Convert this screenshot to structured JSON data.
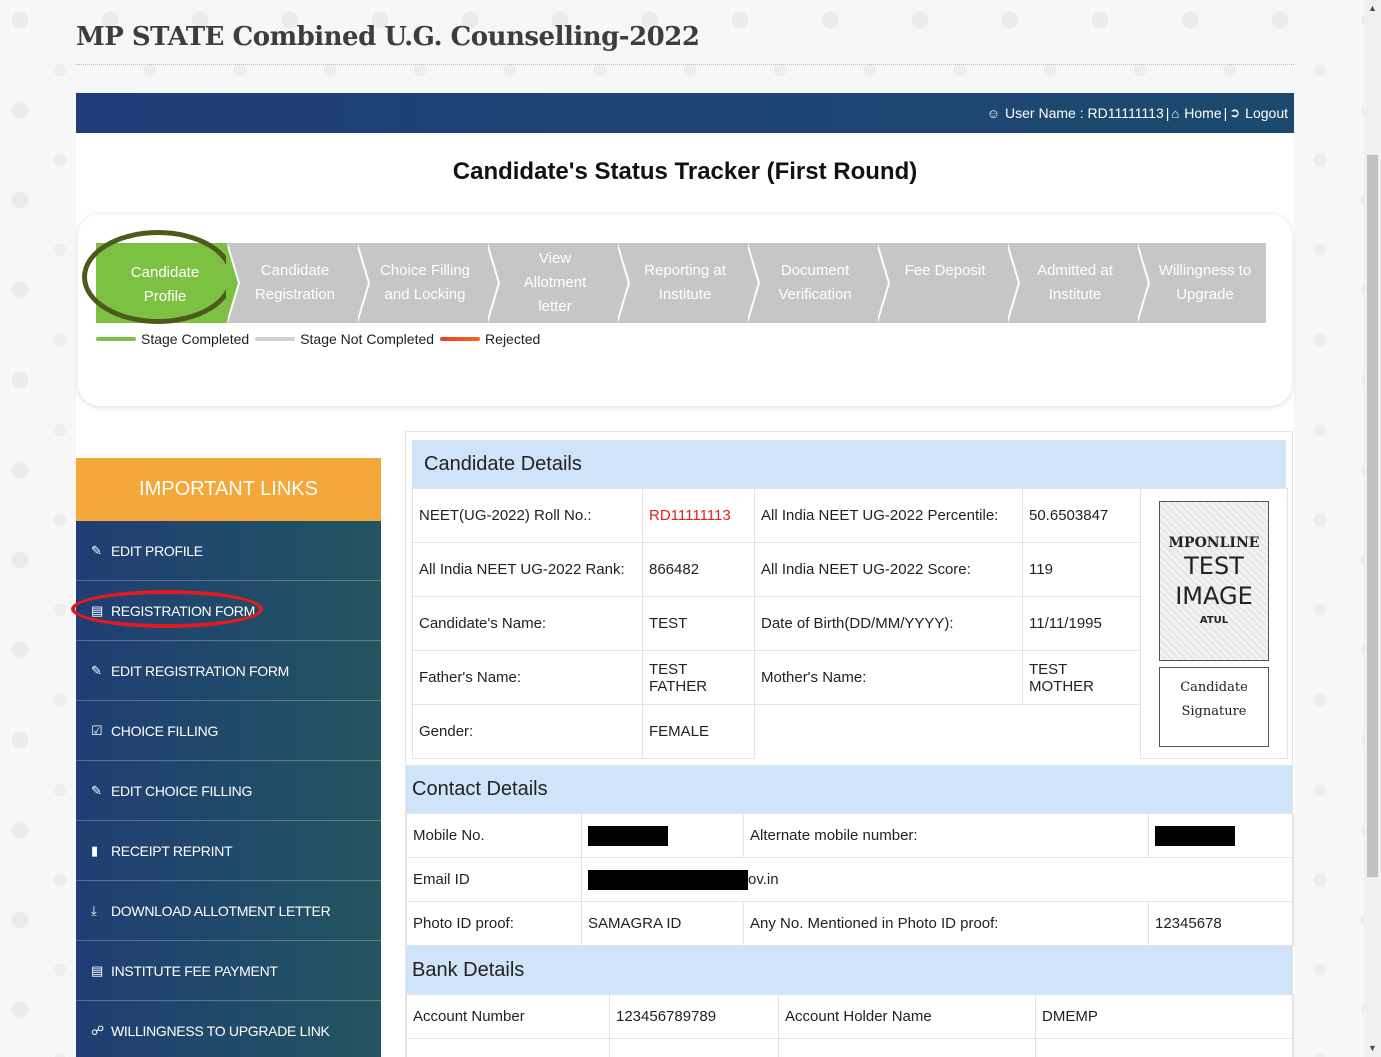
{
  "site_title": "MP STATE Combined U.G. Counselling-2022",
  "topbar": {
    "user_label": "User Name : RD11111113",
    "sep1": "|",
    "home_label": "Home",
    "sep2": "|",
    "logout_label": "Logout"
  },
  "tracker": {
    "title": "Candidate's Status Tracker (First Round)",
    "steps": [
      {
        "label": "Candidate Profile",
        "status": "completed"
      },
      {
        "label": "Candidate Registration",
        "status": "not-completed"
      },
      {
        "label": "Choice Filling and Locking",
        "status": "not-completed"
      },
      {
        "label": "View Allotment letter",
        "status": "not-completed"
      },
      {
        "label": "Reporting at Institute",
        "status": "not-completed"
      },
      {
        "label": "Document Verification",
        "status": "not-completed"
      },
      {
        "label": "Fee Deposit",
        "status": "not-completed"
      },
      {
        "label": "Admitted at Institute",
        "status": "not-completed"
      },
      {
        "label": "Willingness to Upgrade",
        "status": "not-completed"
      }
    ],
    "legend": {
      "completed": "Stage Completed",
      "not_completed": "Stage Not Completed",
      "rejected": "Rejected"
    },
    "colors": {
      "completed": "#7cc142",
      "not_completed": "#c6c6c6",
      "rejected": "#e8402a"
    }
  },
  "links": {
    "heading": "IMPORTANT LINKS",
    "items": [
      {
        "label": "EDIT PROFILE",
        "icon": "edit-icon"
      },
      {
        "label": "REGISTRATION FORM",
        "icon": "id-card-icon"
      },
      {
        "label": "EDIT REGISTRATION FORM",
        "icon": "edit-icon"
      },
      {
        "label": "CHOICE FILLING",
        "icon": "checkbox-icon"
      },
      {
        "label": "EDIT CHOICE FILLING",
        "icon": "edit-icon"
      },
      {
        "label": "RECEIPT REPRINT",
        "icon": "file-icon"
      },
      {
        "label": "DOWNLOAD ALLOTMENT LETTER",
        "icon": "download-icon"
      },
      {
        "label": "INSTITUTE FEE PAYMENT",
        "icon": "credit-card-icon"
      },
      {
        "label": "WILLINGNESS TO UPGRADE LINK",
        "icon": "link-icon"
      }
    ]
  },
  "candidate": {
    "heading": "Candidate Details",
    "roll_label": "NEET(UG-2022) Roll No.:",
    "roll_value": "RD11111113",
    "percentile_label": "All India NEET UG-2022 Percentile:",
    "percentile_value": "50.6503847",
    "rank_label": "All India NEET UG-2022 Rank:",
    "rank_value": "866482",
    "score_label": "All India NEET UG-2022 Score:",
    "score_value": "119",
    "name_label": "Candidate's Name:",
    "name_value": "TEST",
    "dob_label": "Date of Birth(DD/MM/YYYY):",
    "dob_value": "11/11/1995",
    "father_label": "Father's Name:",
    "father_value": "TEST FATHER",
    "mother_label": "Mother's Name:",
    "mother_value": "TEST MOTHER",
    "gender_label": "Gender:",
    "gender_value": "FEMALE",
    "photo": {
      "line1": "MPONLINE",
      "line2": "TEST",
      "line3": "IMAGE",
      "line4": "ATUL"
    },
    "signature": {
      "line1": "Candidate",
      "line2": "Signature"
    }
  },
  "contact": {
    "heading": "Contact Details",
    "mobile_label": "Mobile No.",
    "alt_mobile_label": "Alternate mobile number:",
    "email_label": "Email ID",
    "email_suffix": "ov.in",
    "photo_id_label": "Photo ID proof:",
    "photo_id_value": "SAMAGRA ID",
    "photo_id_no_label": "Any No. Mentioned in Photo ID proof:",
    "photo_id_no_value": "12345678"
  },
  "bank": {
    "heading": "Bank Details",
    "account_label": "Account Number",
    "account_value": "123456789789",
    "holder_label": "Account Holder Name",
    "holder_value": "DMEMP"
  }
}
